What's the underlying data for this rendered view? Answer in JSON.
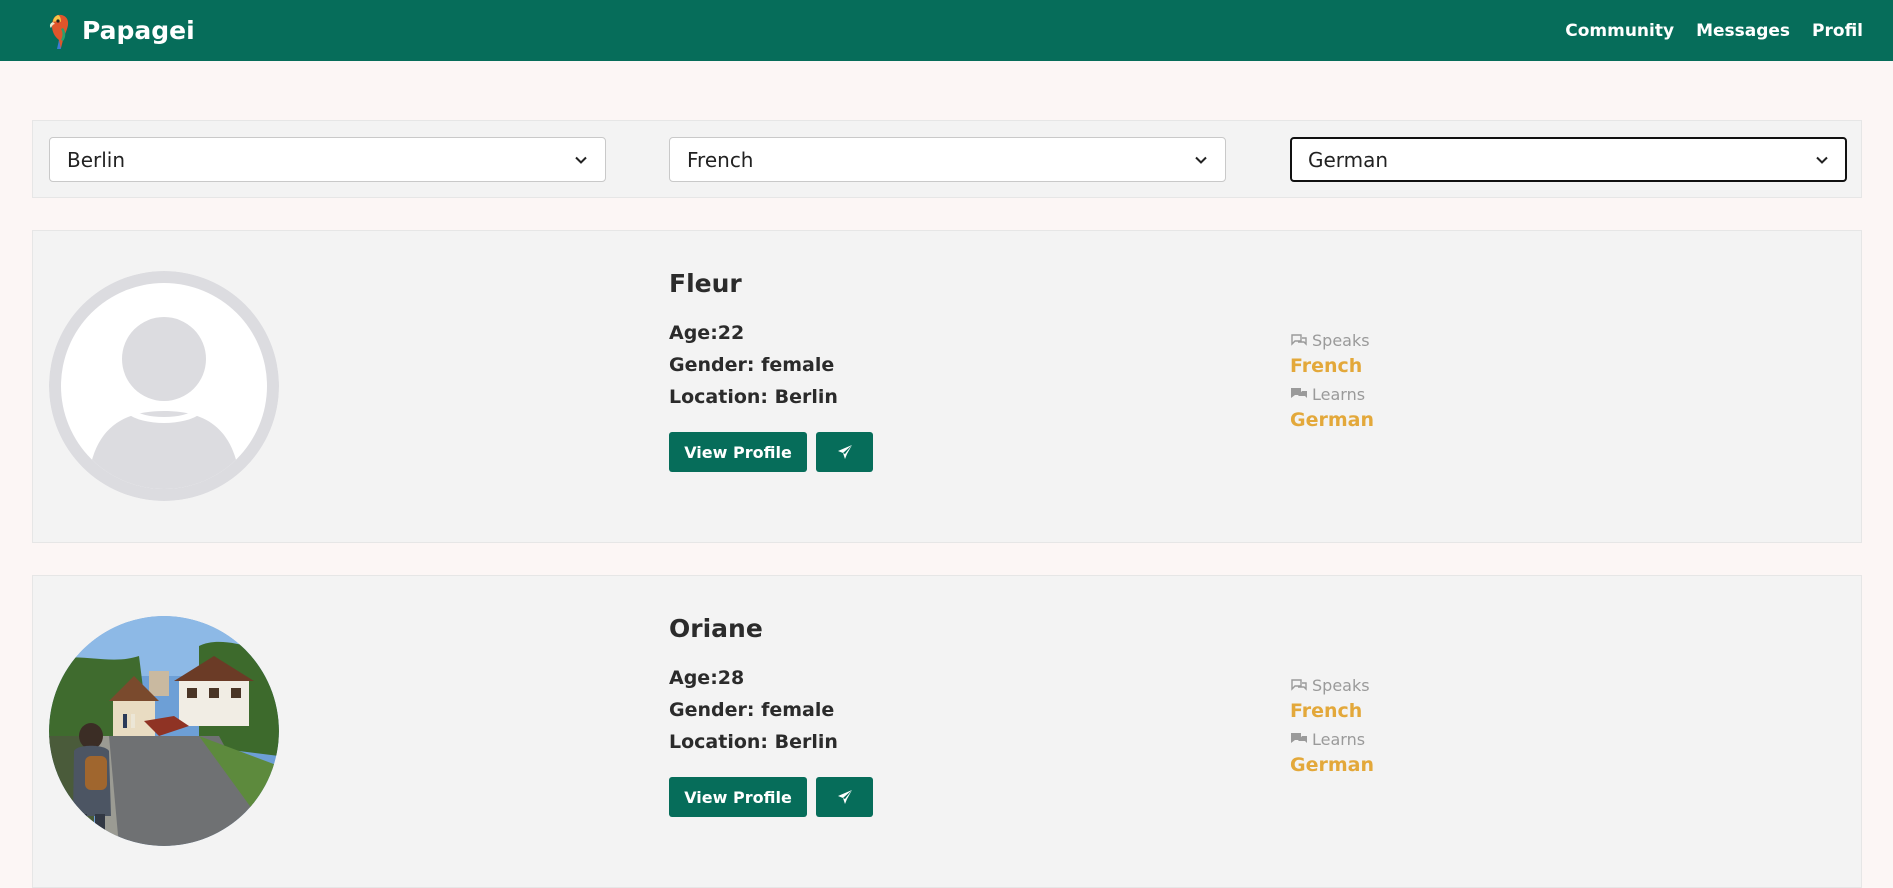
{
  "header": {
    "brand": "Papagei",
    "nav": [
      "Community",
      "Messages",
      "Profil"
    ]
  },
  "filters": {
    "location": "Berlin",
    "speaks": "French",
    "learns": "German"
  },
  "labels": {
    "age": "Age:",
    "gender": "Gender: ",
    "location": "Location: ",
    "speaks": "Speaks",
    "learns": "Learns",
    "view_profile": "View Profile"
  },
  "users": [
    {
      "name": "Fleur",
      "age": "22",
      "gender": "female",
      "location": "Berlin",
      "speaks": "French",
      "learns": "German",
      "avatar": "default-avatar-icon"
    },
    {
      "name": "Oriane",
      "age": "28",
      "gender": "female",
      "location": "Berlin",
      "speaks": "French",
      "learns": "German",
      "avatar": "photo-village-street"
    }
  ],
  "colors": {
    "primary": "#066d5a",
    "accent": "#e3a83a",
    "background": "#fcf6f5",
    "card": "#f3f3f3"
  }
}
